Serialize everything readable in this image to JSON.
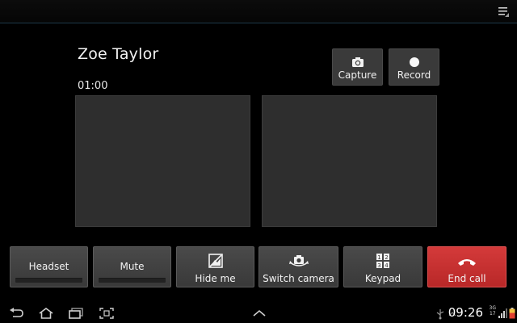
{
  "topbar": {
    "menu_icon": "menu-icon"
  },
  "call": {
    "caller_name": "Zoe Taylor",
    "timer": "01:00"
  },
  "media_controls": {
    "capture_label": "Capture",
    "capture_icon": "camera-icon",
    "record_label": "Record",
    "record_icon": "record-dot-icon"
  },
  "controls": {
    "headset_label": "Headset",
    "mute_label": "Mute",
    "hide_me_label": "Hide me",
    "switch_camera_label": "Switch camera",
    "keypad_label": "Keypad",
    "keypad_digits": [
      "1",
      "2",
      "3",
      "4"
    ],
    "end_call_label": "End call"
  },
  "colors": {
    "end_call": "#c83030",
    "button": "#424242",
    "video_pane": "#2e2e2e",
    "background": "#000000"
  },
  "statusbar": {
    "clock": "09:26",
    "network_type_top": "3G",
    "network_type_bottom": "17"
  }
}
